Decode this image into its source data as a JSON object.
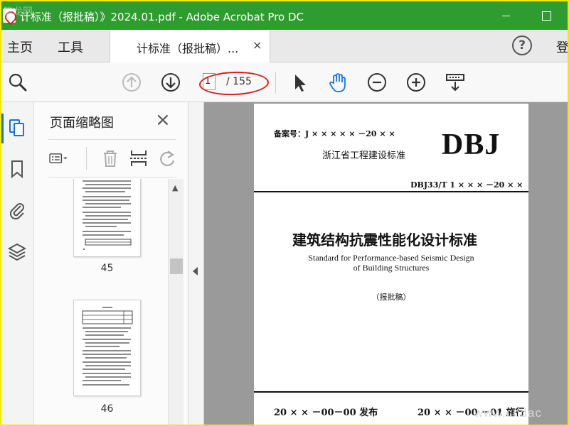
{
  "window": {
    "title": "计标准（报批稿）》2024.01.pdf - Adobe Acrobat Pro DC",
    "watermark_top": "筑龙网"
  },
  "menu": {
    "home": "主页",
    "tools": "工具",
    "doc_tab": "计标准（报批稿）...",
    "tab_close": "×",
    "help": "?",
    "login": "登"
  },
  "toolbar": {
    "current_page": "1",
    "page_total": "/ 155"
  },
  "thumbnails": {
    "title": "页面缩略图",
    "close": "×",
    "pages": [
      {
        "label": "45"
      },
      {
        "label": "46"
      }
    ]
  },
  "document": {
    "filing": "备案号：J × × × × × －20 × ×",
    "std_line": "浙江省工程建设标准",
    "logo": "DBJ",
    "code": "DBJ33/T 1 × × × －20 × ×",
    "cn_title": "建筑结构抗震性能化设计标准",
    "en_title_line1": "Standard for Performance-based Seismic Design",
    "en_title_line2": "of Building Structures",
    "draft": "（报批稿）",
    "issue": "20 × × －00－00 发布",
    "implement": "20 × × －00 －01 施行",
    "watermark": "www.cndac"
  },
  "colors": {
    "title_bar": "#2e9c2e",
    "accent_blue": "#1473e6",
    "annotation_red": "#d42020",
    "outer_border": "#f0e800"
  }
}
